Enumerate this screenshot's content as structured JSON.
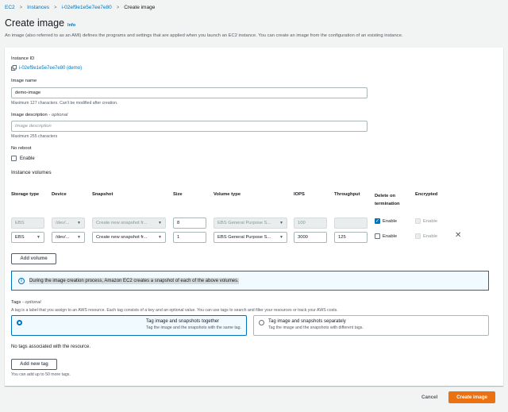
{
  "breadcrumb": [
    "EC2",
    "Instances",
    "i-02ef9e1e5e7ee7e80",
    "Create image"
  ],
  "page": {
    "title": "Create image",
    "info": "Info",
    "description": "An image (also referred to as an AMI) defines the programs and settings that are applied when you launch an EC2 instance. You can create an image from the configuration of an existing instance."
  },
  "form": {
    "instance_id_label": "Instance ID",
    "instance_id_value": "i-02ef9e1e5e7ee7e80 (demo)",
    "image_name_label": "Image name",
    "image_name_value": "demo-image",
    "image_name_hint": "Maximum 127 characters. Can't be modified after creation.",
    "image_desc_label": "Image description",
    "image_desc_optional": "- optional",
    "image_desc_placeholder": "Image description",
    "image_desc_hint": "Maximum 255 characters",
    "no_reboot_label": "No reboot",
    "enable_label": "Enable",
    "instance_volumes_label": "Instance volumes"
  },
  "volumes": {
    "headers": [
      "Storage type",
      "Device",
      "Snapshot",
      "Size",
      "Volume type",
      "IOPS",
      "Throughput",
      "Delete on termination",
      "Encrypted"
    ],
    "rows": [
      {
        "storage": "EBS",
        "device": "/dev/...",
        "snapshot": "Create new snapshot fr...",
        "size": "8",
        "volume_type": "EBS General Purpose S...",
        "iops": "100",
        "throughput": "",
        "delete_on_term": true,
        "delete_label": "Enable",
        "encrypted_label": "Enable"
      },
      {
        "storage": "EBS",
        "device": "/dev/...",
        "snapshot": "Create new snapshot fr...",
        "size": "1",
        "volume_type": "EBS General Purpose S...",
        "iops": "3000",
        "throughput": "125",
        "delete_on_term": false,
        "delete_label": "Enable",
        "encrypted_label": "Enable"
      }
    ],
    "add_volume": "Add volume"
  },
  "alert": {
    "text": "During the image creation process, Amazon EC2 creates a snapshot of each of the above volumes."
  },
  "tags": {
    "label": "Tags",
    "optional": "- optional",
    "description": "A tag is a label that you assign to an AWS resource. Each tag consists of a key and an optional value. You can use tags to search and filter your resources or track your AWS costs.",
    "option1_title": "Tag image and snapshots together",
    "option1_sub": "Tag the image and the snapshots with the same tag.",
    "option2_title": "Tag image and snapshots separately",
    "option2_sub": "Tag the image and the snapshots with different tags.",
    "none_text": "No tags associated with the resource.",
    "add_tag": "Add new tag",
    "limit_hint": "You can add up to 50 more tags."
  },
  "footer": {
    "cancel": "Cancel",
    "create": "Create image"
  }
}
